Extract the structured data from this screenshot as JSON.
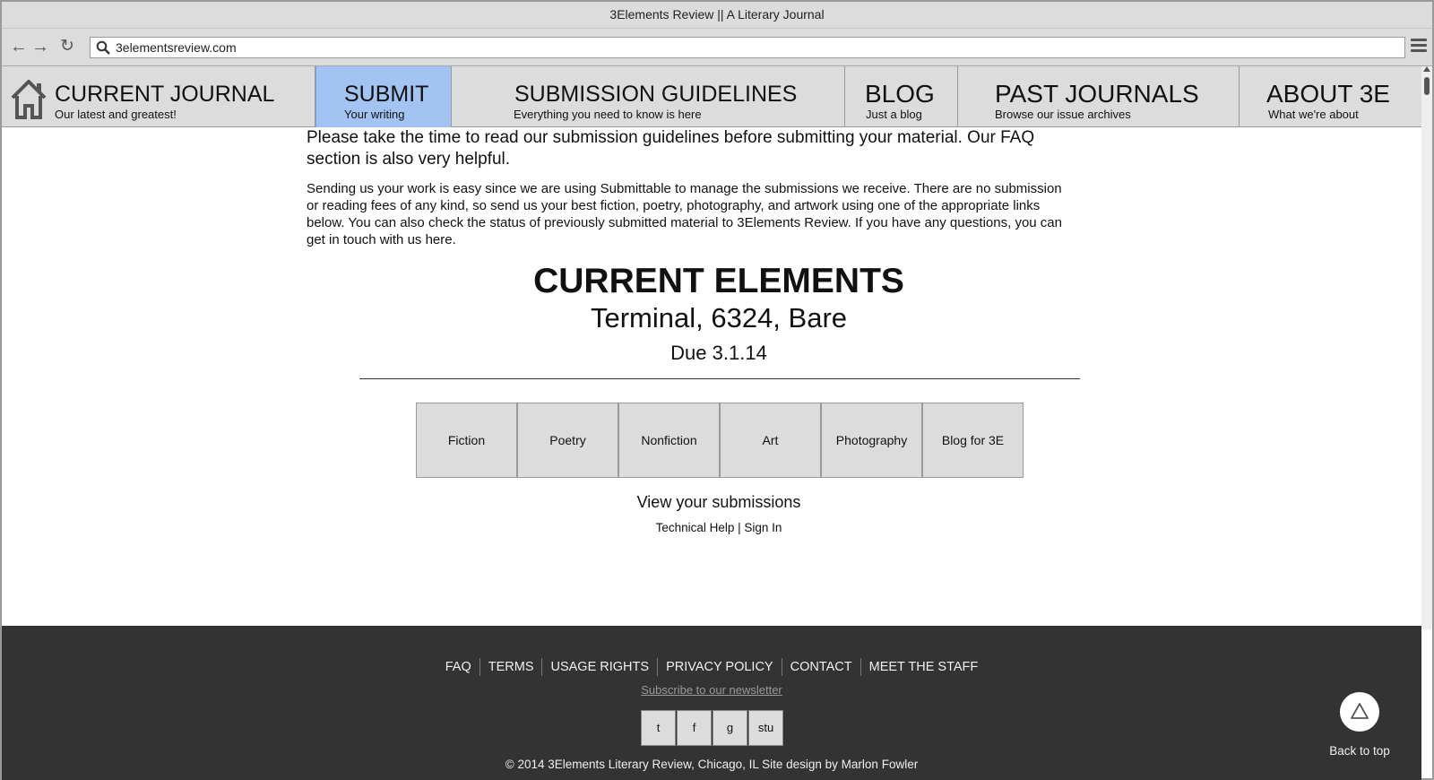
{
  "window": {
    "title": "3Elements Review || A Literary Journal"
  },
  "browser": {
    "url": "3elementsreview.com"
  },
  "nav": {
    "items": [
      {
        "label": "CURRENT JOURNAL",
        "sub": "Our latest and greatest!"
      },
      {
        "label": "SUBMIT",
        "sub": "Your writing"
      },
      {
        "label": "SUBMISSION GUIDELINES",
        "sub": "Everything you need to know is here"
      },
      {
        "label": "BLOG",
        "sub": "Just a blog"
      },
      {
        "label": "PAST JOURNALS",
        "sub": "Browse our issue archives"
      },
      {
        "label": "ABOUT 3E",
        "sub": "What we're about"
      }
    ],
    "active": "SUBMIT"
  },
  "content": {
    "lead": "Please take the time to read our submission guidelines before submitting your material. Our FAQ section is also very helpful.",
    "body": "Sending us your work is easy since we are using Submittable to manage the submissions we receive. There are no submission or reading fees of any kind, so send us your best fiction, poetry, photography, and artwork using one of the appropriate links below. You can also check the status of previously submitted material to 3Elements Review. If you have any questions, you can get in touch with us here.",
    "current_title": "CURRENT ELEMENTS",
    "current_elements": "Terminal, 6324, Bare",
    "due": "Due 3.1.14",
    "categories": [
      "Fiction",
      "Poetry",
      "Nonfiction",
      "Art",
      "Photography",
      "Blog for 3E"
    ],
    "view_submissions": "View your submissions",
    "help_links": "Technical Help | Sign In"
  },
  "footer": {
    "links": [
      "FAQ",
      "TERMS",
      "USAGE RIGHTS",
      "PRIVACY POLICY",
      "CONTACT",
      "MEET THE STAFF"
    ],
    "newsletter": "Subscribe to our newsletter",
    "social": [
      "t",
      "f",
      "g",
      "stu"
    ],
    "copyright": "© 2014 3Elements Literary Review, Chicago, IL Site design by Marlon Fowler",
    "back_to_top": "Back to top"
  },
  "colors": {
    "active_tab": "#a3c4f3",
    "footer_bg": "#333333",
    "chrome": "#dcdcdc"
  }
}
